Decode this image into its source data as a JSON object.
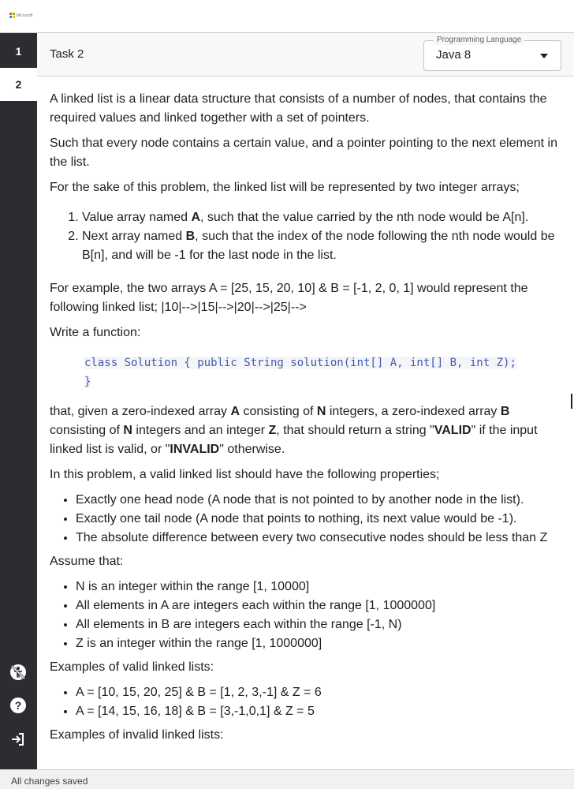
{
  "brand": {
    "logo_text": "Microsoft",
    "colors": [
      "#f25022",
      "#7fba00",
      "#00a4ef",
      "#ffb900"
    ]
  },
  "sidebar": {
    "tasks": [
      "1",
      "2"
    ],
    "active_task": "2",
    "icons": [
      "accessibility-off-icon",
      "help-icon",
      "exit-icon"
    ]
  },
  "task": {
    "title": "Task 2",
    "language_label": "Programming Language",
    "language_value": "Java 8"
  },
  "content": {
    "intro_1": "A linked list is a linear data structure that consists of a number of nodes, that contains the required values and linked together with a set of pointers.",
    "intro_2": "Such that every node contains a certain value, and a pointer pointing to the next element in the list.",
    "intro_3": "For the sake of this problem, the linked list will be represented by two integer arrays;",
    "ol_1_pre": "Value array named ",
    "ol_1_bold": "A",
    "ol_1_post": ", such that the value carried by the nth node would be A[n].",
    "ol_2_pre": "Next array named ",
    "ol_2_bold": "B",
    "ol_2_post": ", such that the index of the node following the nth node would be B[n], and will be -1 for the last node in the list.",
    "example_text": "For example, the two arrays A = [25, 15, 20, 10] & B = [-1, 2, 0, 1] would represent the following linked list; |10|-->|15|-->|20|-->|25|-->",
    "write_function": "Write a function:",
    "code_line_1": "class Solution { public String solution(int[] A, int[] B, int Z);",
    "code_line_2": "}",
    "given_1": "that, given a zero-indexed array ",
    "given_A": "A",
    "given_2": " consisting of ",
    "given_N": "N",
    "given_3": " integers, a zero-indexed array ",
    "given_B": "B",
    "given_4": " consisting of ",
    "given_N2": "N",
    "given_5": " integers and an integer ",
    "given_Z": "Z",
    "given_6": ", that should return a string \"",
    "given_valid": "VALID",
    "given_7": "\" if the input linked list is valid, or \"",
    "given_invalid": "INVALID",
    "given_8": "\" otherwise.",
    "properties_intro": "In this problem, a valid linked list should have the following properties;",
    "properties": [
      "Exactly one head node (A node that is not pointed to by another node in the list).",
      "Exactly one tail node (A node that points to nothing, its next value would be -1).",
      "The absolute difference between every two consecutive nodes should be less than Z"
    ],
    "assume_intro": "Assume that:",
    "assumptions": [
      "N is an integer within the range [1, 10000]",
      "All elements in A are integers each within the range [1, 1000000]",
      "All elements in B are integers each within the range [-1, N)",
      "Z is an integer within the range [1, 1000000]"
    ],
    "valid_intro": "Examples of valid linked lists:",
    "valid_examples": [
      "A = [10, 15, 20, 25] & B = [1, 2, 3,-1] & Z = 6",
      "A = [14, 15, 16, 18] & B = [3,-1,0,1] & Z = 5"
    ],
    "invalid_intro": "Examples of invalid linked lists:"
  },
  "status": {
    "text": "All changes saved"
  }
}
